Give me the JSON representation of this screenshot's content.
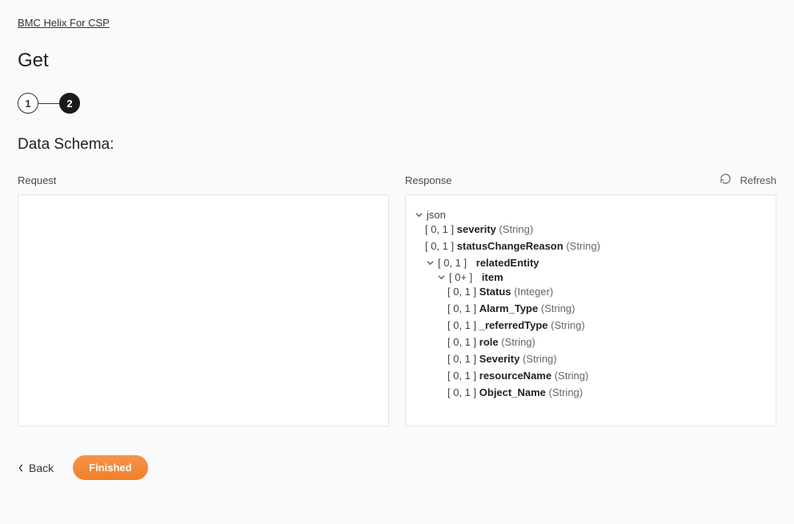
{
  "breadcrumb": "BMC Helix For CSP",
  "page_title": "Get",
  "stepper": {
    "steps": [
      "1",
      "2"
    ],
    "active_index": 1
  },
  "section_title": "Data Schema:",
  "refresh_label": "Refresh",
  "columns": {
    "request": {
      "label": "Request"
    },
    "response": {
      "label": "Response",
      "tree": {
        "root": {
          "label": "json",
          "expanded": true,
          "children": [
            {
              "card": "[ 0, 1 ]",
              "name": "severity",
              "type": "(String)"
            },
            {
              "card": "[ 0, 1 ]",
              "name": "statusChangeReason",
              "type": "(String)"
            },
            {
              "card": "[ 0, 1 ]",
              "name": "relatedEntity",
              "expanded": true,
              "children": [
                {
                  "card": "[ 0+ ]",
                  "name": "item",
                  "expanded": true,
                  "children": [
                    {
                      "card": "[ 0, 1 ]",
                      "name": "Status",
                      "type": "(Integer)"
                    },
                    {
                      "card": "[ 0, 1 ]",
                      "name": "Alarm_Type",
                      "type": "(String)"
                    },
                    {
                      "card": "[ 0, 1 ]",
                      "name": "_referredType",
                      "type": "(String)"
                    },
                    {
                      "card": "[ 0, 1 ]",
                      "name": "role",
                      "type": "(String)"
                    },
                    {
                      "card": "[ 0, 1 ]",
                      "name": "Severity",
                      "type": "(String)"
                    },
                    {
                      "card": "[ 0, 1 ]",
                      "name": "resourceName",
                      "type": "(String)"
                    },
                    {
                      "card": "[ 0, 1 ]",
                      "name": "Object_Name",
                      "type": "(String)"
                    }
                  ]
                }
              ]
            }
          ]
        }
      }
    }
  },
  "footer": {
    "back": "Back",
    "finished": "Finished"
  }
}
